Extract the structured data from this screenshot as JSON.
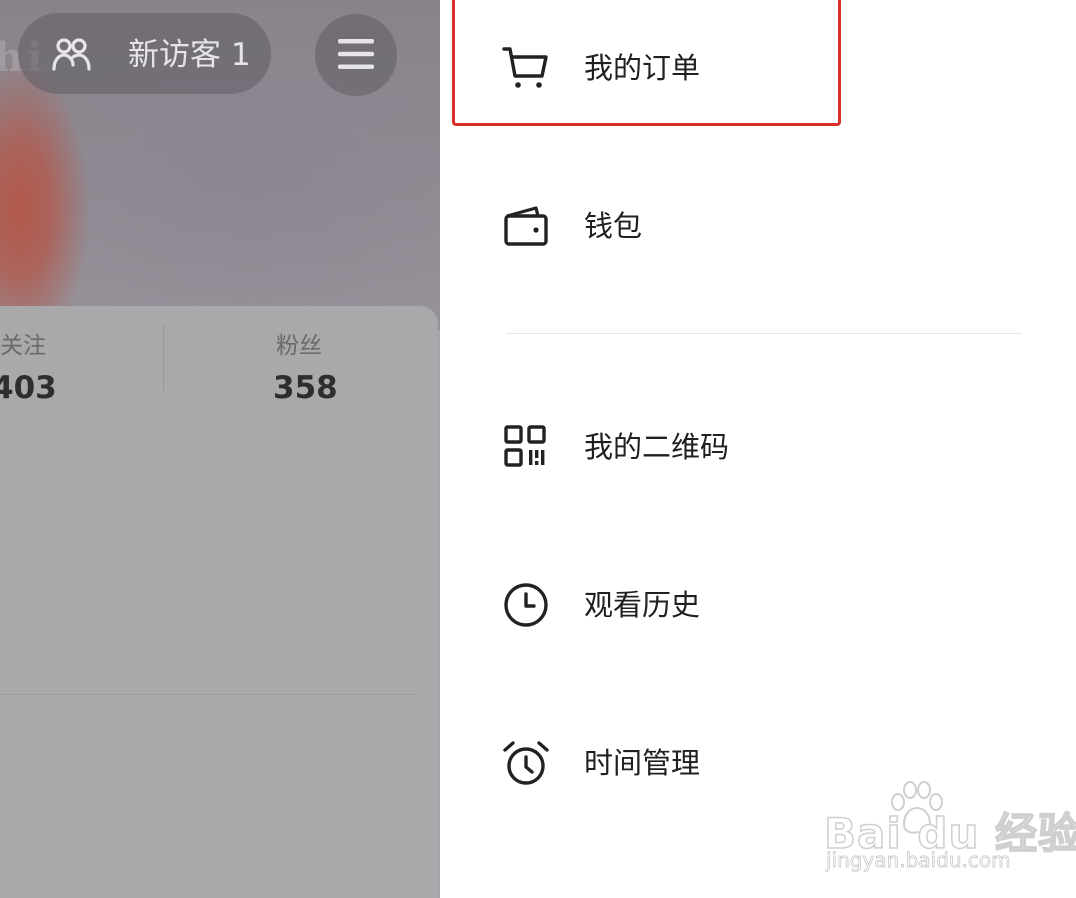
{
  "profile": {
    "visitor_label": "新访客 1",
    "stats": [
      {
        "label": "关注",
        "value": "403"
      },
      {
        "label": "粉丝",
        "value": "358"
      }
    ]
  },
  "drawer": {
    "items": [
      {
        "label": "我的订单",
        "icon": "cart-icon",
        "highlighted": true
      },
      {
        "label": "钱包",
        "icon": "wallet-icon"
      },
      {
        "label": "我的二维码",
        "icon": "qr-code-icon"
      },
      {
        "label": "观看历史",
        "icon": "clock-icon"
      },
      {
        "label": "时间管理",
        "icon": "alarm-clock-icon"
      }
    ]
  },
  "watermark": {
    "brand": "Bai du 经验",
    "url": "jingyan.baidu.com"
  },
  "colors": {
    "highlight": "#d9302c",
    "overlay": "#a7a5a9",
    "text": "#202020"
  }
}
